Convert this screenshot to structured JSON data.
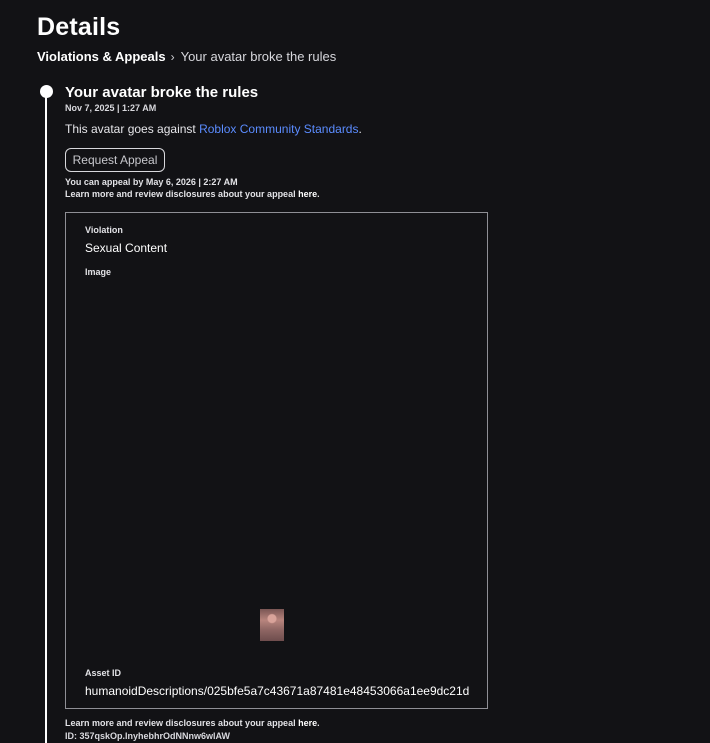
{
  "page": {
    "title": "Details"
  },
  "breadcrumb": {
    "parent": "Violations & Appeals",
    "separator": "›",
    "current": "Your avatar broke the rules"
  },
  "entry": {
    "title": "Your avatar broke the rules",
    "date": "Nov 7, 2025 | 1:27 AM",
    "description_prefix": "This avatar goes against ",
    "description_link": "Roblox Community Standards",
    "description_suffix": ".",
    "appeal_button_label": "Request Appeal",
    "appeal_deadline": "You can appeal by May 6, 2026 | 2:27 AM",
    "learn_more_text": "Learn more and review disclosures about your appeal ",
    "learn_more_link": "here",
    "learn_more_suffix": "."
  },
  "violation": {
    "violation_label": "Violation",
    "violation_value": "Sexual Content",
    "image_label": "Image",
    "asset_label": "Asset ID",
    "asset_value": "humanoidDescriptions/025bfe5a7c43671a87481e48453066a1ee9dc21d"
  },
  "footer": {
    "learn_more_text": "Learn more and review disclosures about your appeal ",
    "learn_more_link": "here",
    "learn_more_suffix": ".",
    "id_text": "ID: 357qskOp.lnyhebhrOdNNnw6wlAW"
  }
}
